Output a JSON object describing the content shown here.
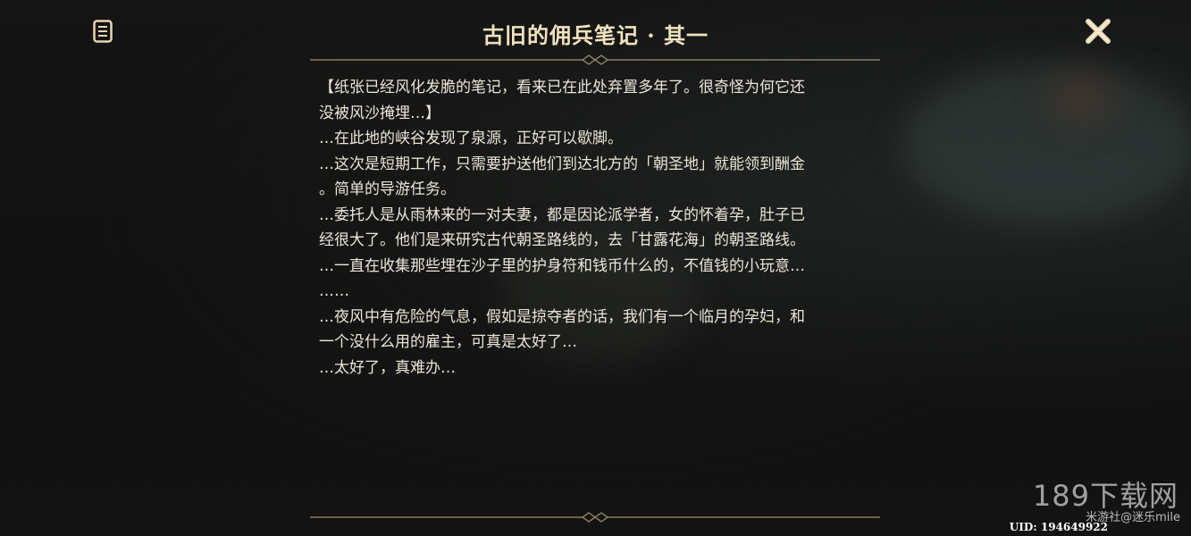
{
  "header": {
    "title": "古旧的佣兵笔记 · 其一",
    "left_icon": "notes-icon",
    "close_icon": "close-icon"
  },
  "colors": {
    "title": "#f1e2bf",
    "body_text": "#ece6d8",
    "divider": "#8b7d5f"
  },
  "note": {
    "paragraphs": [
      "【纸张已经风化发脆的笔记，看来已在此处弃置多年了。很奇怪为何它还\n没被风沙掩埋…】",
      "…在此地的峡谷发现了泉源，正好可以歇脚。",
      "…这次是短期工作，只需要护送他们到达北方的「朝圣地」就能领到酬金\n。简单的导游任务。",
      "…委托人是从雨林来的一对夫妻，都是因论派学者，女的怀着孕，肚子已\n经很大了。他们是来研究古代朝圣路线的，去「甘露花海」的朝圣路线。",
      "…一直在收集那些埋在沙子里的护身符和钱币什么的，不值钱的小玩意…\n……",
      "…夜风中有危险的气息，假如是掠夺者的话，我们有一个临月的孕妇，和\n一个没什么用的雇主，可真是太好了…",
      "…太好了，真难办…"
    ]
  },
  "watermark": {
    "site": "189下载网",
    "sub": "米游社@迷乐mile",
    "uid": "UID: 194649922"
  }
}
